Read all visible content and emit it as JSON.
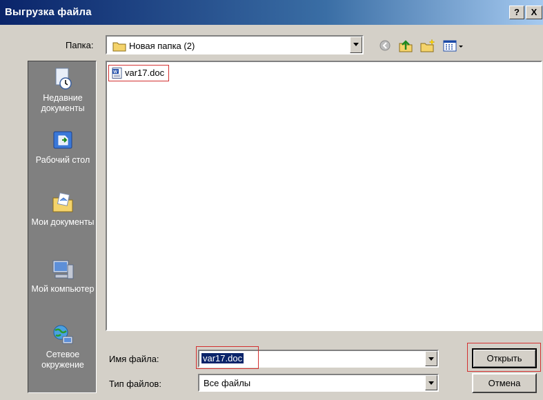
{
  "window": {
    "title": "Выгрузка файла",
    "help_label": "?",
    "close_label": "X"
  },
  "toolbar": {
    "folder_label": "Папка:",
    "folder_value": "Новая папка (2)",
    "icons": [
      "back-icon",
      "up-folder-icon",
      "new-folder-icon",
      "view-menu-icon"
    ]
  },
  "places": [
    {
      "label": "Недавние документы",
      "icon": "recent-documents-icon"
    },
    {
      "label": "Рабочий стол",
      "icon": "desktop-icon"
    },
    {
      "label": "Мои документы",
      "icon": "my-documents-icon"
    },
    {
      "label": "Мой компьютер",
      "icon": "my-computer-icon"
    },
    {
      "label": "Сетевое окружение",
      "icon": "network-icon"
    }
  ],
  "files": [
    {
      "name": "var17.doc",
      "icon": "word-document-icon"
    }
  ],
  "form": {
    "filename_label": "Имя файла:",
    "filename_value": "var17.doc",
    "filetype_label": "Тип файлов:",
    "filetype_value": "Все файлы",
    "open_label": "Открыть",
    "cancel_label": "Отмена"
  },
  "colors": {
    "titlebar": "#0a246a",
    "highlight": "#d32f2f",
    "dialog": "#d4d0c8"
  }
}
